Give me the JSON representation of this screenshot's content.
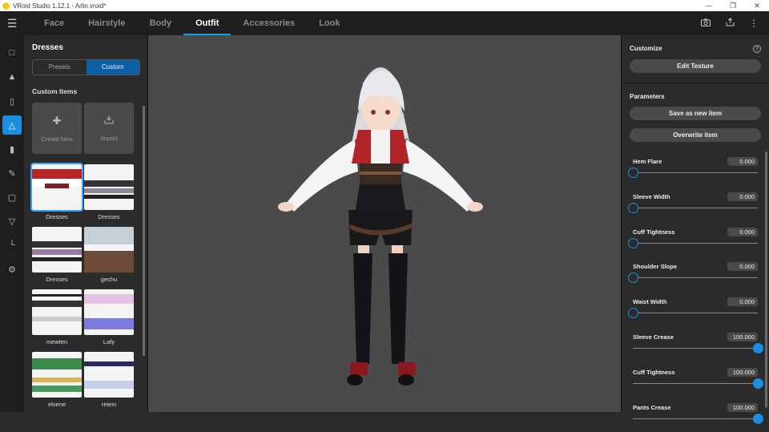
{
  "window": {
    "title": "VRoid Studio 1.12.1 - Arlin.vroid*"
  },
  "nav": {
    "tabs": [
      {
        "label": "Face"
      },
      {
        "label": "Hairstyle"
      },
      {
        "label": "Body"
      },
      {
        "label": "Outfit"
      },
      {
        "label": "Accessories"
      },
      {
        "label": "Look"
      }
    ],
    "active_tab": "Outfit"
  },
  "left_panel": {
    "title": "Dresses",
    "segments": [
      {
        "label": "Presets"
      },
      {
        "label": "Custom"
      }
    ],
    "active_segment": "Custom",
    "section_title": "Custom Items",
    "actions": [
      {
        "label": "Create New",
        "icon": "plus-icon"
      },
      {
        "label": "Import",
        "icon": "import-icon"
      }
    ],
    "items": [
      {
        "label": "Dresses"
      },
      {
        "label": "Dresses"
      },
      {
        "label": "Dresses"
      },
      {
        "label": "gechu"
      },
      {
        "label": "mewten"
      },
      {
        "label": "Lafy"
      },
      {
        "label": "elvene"
      },
      {
        "label": "reiein"
      }
    ]
  },
  "right_panel": {
    "customize_title": "Customize",
    "edit_texture_label": "Edit Texture",
    "parameters_title": "Parameters",
    "save_label": "Save as new item",
    "overwrite_label": "Overwrite item",
    "params": [
      {
        "label": "Hem Flare",
        "value": "0.000",
        "fraction": 0
      },
      {
        "label": "Sleeve Width",
        "value": "0.000",
        "fraction": 0
      },
      {
        "label": "Cuff Tightness",
        "value": "0.000",
        "fraction": 0
      },
      {
        "label": "Shoulder Slope",
        "value": "0.000",
        "fraction": 0
      },
      {
        "label": "Waist Width",
        "value": "0.000",
        "fraction": 0
      },
      {
        "label": "Sleeve Crease",
        "value": "100.000",
        "fraction": 1
      },
      {
        "label": "Cuff Tightness",
        "value": "100.000",
        "fraction": 1
      },
      {
        "label": "Pants Crease",
        "value": "100.000",
        "fraction": 1
      }
    ]
  },
  "colors": {
    "accent": "#1a8fe0",
    "viewport_bg": "#4a4a4a",
    "panel_bg": "#2b2b2b"
  }
}
